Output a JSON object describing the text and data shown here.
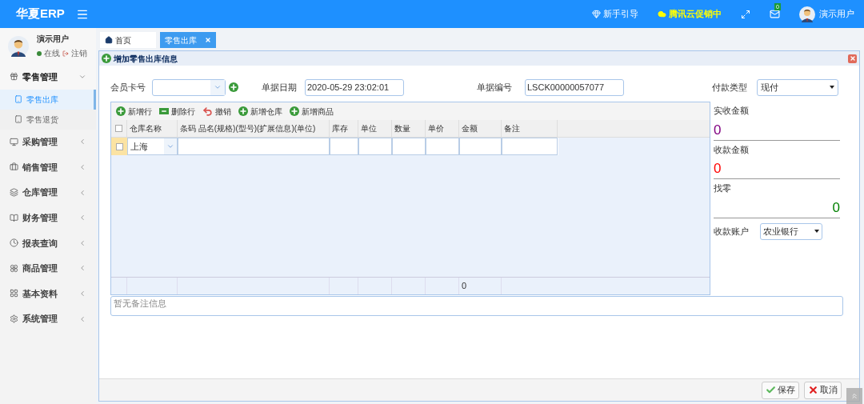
{
  "header": {
    "logo": "华夏ERP",
    "links": [
      {
        "kind": "guide",
        "label": "新手引导"
      },
      {
        "kind": "promo",
        "label": "腾讯云促销中"
      }
    ],
    "mail_count": "0",
    "user": "演示用户"
  },
  "sidebar": {
    "user": {
      "name": "演示用户",
      "status": "在线",
      "logout": "注销"
    },
    "items": [
      {
        "label": "零售管理",
        "expanded": true,
        "children": [
          {
            "label": "零售出库",
            "selected": true
          },
          {
            "label": "零售退货",
            "selected": false
          }
        ]
      },
      {
        "label": "采购管理",
        "expanded": false
      },
      {
        "label": "销售管理",
        "expanded": false
      },
      {
        "label": "仓库管理",
        "expanded": false
      },
      {
        "label": "财务管理",
        "expanded": false
      },
      {
        "label": "报表查询",
        "expanded": false
      },
      {
        "label": "商品管理",
        "expanded": false
      },
      {
        "label": "基本资料",
        "expanded": false
      },
      {
        "label": "系统管理",
        "expanded": false
      }
    ]
  },
  "tabs": [
    {
      "label": "首页",
      "selected": false,
      "closable": false
    },
    {
      "label": "零售出库",
      "selected": true,
      "closable": true
    }
  ],
  "panel": {
    "title": "增加零售出库信息",
    "fields": [
      {
        "label": "会员卡号",
        "kind": "combo"
      },
      {
        "label": "单据日期",
        "value": "2020-05-29 23:02:01",
        "kind": "text"
      },
      {
        "label": "单据编号",
        "value": "LSCK00000057077",
        "kind": "text"
      },
      {
        "label": "付款类型",
        "value": "现付",
        "kind": "select"
      }
    ],
    "toolbar": [
      {
        "label": "新增行",
        "kind": "add"
      },
      {
        "label": "删除行",
        "kind": "remove"
      },
      {
        "label": "撤销",
        "kind": "undo"
      },
      {
        "label": "新增仓库",
        "kind": "add"
      },
      {
        "label": "新增商品",
        "kind": "add"
      }
    ],
    "table": {
      "columns": [
        "仓库名称",
        "条码 品名(规格)(型号)(扩展信息)(单位)",
        "库存",
        "单位",
        "数量",
        "单价",
        "金额",
        "备注"
      ],
      "all_checked": false,
      "rows": [
        {
          "checked": false,
          "warehouse": "上海"
        }
      ],
      "footer": {
        "amount": "0"
      }
    },
    "summary": [
      {
        "label": "实收金额",
        "value": "0",
        "color": "#800080",
        "kind": "received"
      },
      {
        "label": "收款金额",
        "value": "0",
        "color": "#ff0000",
        "kind": "paid"
      },
      {
        "label": "找零",
        "value": "0",
        "color": "#008000",
        "kind": "change"
      }
    ],
    "account": {
      "label": "收款账户",
      "value": "农业银行"
    },
    "remark": {
      "placeholder": "暂无备注信息"
    },
    "buttons": [
      {
        "label": "保存",
        "kind": "save"
      },
      {
        "label": "取消",
        "kind": "cancel"
      }
    ]
  }
}
